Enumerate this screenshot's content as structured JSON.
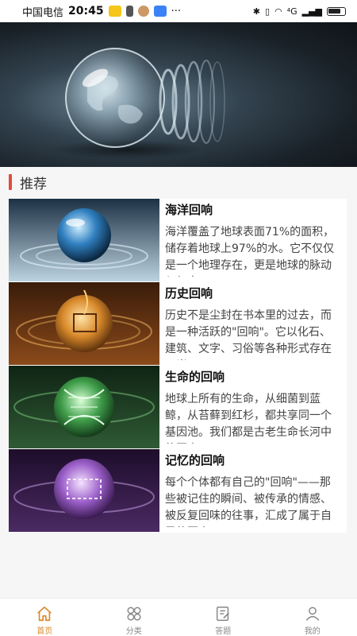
{
  "status_bar": {
    "carrier": "中国电信",
    "time": "20:45",
    "more": "···",
    "network": "⁴G",
    "battery_level": 0.7
  },
  "hero": {
    "icon": "crystal-globe-image"
  },
  "section": {
    "title": "推荐"
  },
  "cards": [
    {
      "title": "海洋回响",
      "desc": "海洋覆盖了地球表面71%的面积，储存着地球上97%的水。它不仅仅是一个地理存在，更是地球的脉动与气息。",
      "image": "ocean-orb",
      "color": "#2f7fbf"
    },
    {
      "title": "历史回响",
      "desc": "历史不是尘封在书本里的过去，而是一种活跃的\"回响\"。它以化石、建筑、文字、习俗等各种形式存在于当下。",
      "image": "history-orb",
      "color": "#d98a2b"
    },
    {
      "title": "生命的回响",
      "desc": "地球上所有的生命，从细菌到蓝鲸，从苔藓到红杉，都共享同一个基因池。我们都是古老生命长河中的回声。",
      "image": "dna-orb",
      "color": "#3f9e4a"
    },
    {
      "title": "记忆的回响",
      "desc": "每个个体都有自己的\"回响\"——那些被记住的瞬间、被传承的情感、被反复回味的往事，汇成了属于自己的回声。",
      "image": "memory-orb",
      "color": "#9b5fc9"
    }
  ],
  "tabs": [
    {
      "label": "首页",
      "icon": "home-icon",
      "active": true
    },
    {
      "label": "分类",
      "icon": "category-icon",
      "active": false
    },
    {
      "label": "答题",
      "icon": "quiz-icon",
      "active": false
    },
    {
      "label": "我的",
      "icon": "profile-icon",
      "active": false
    }
  ],
  "colors": {
    "accent": "#e24a3f",
    "active_tab": "#d98a2b"
  }
}
